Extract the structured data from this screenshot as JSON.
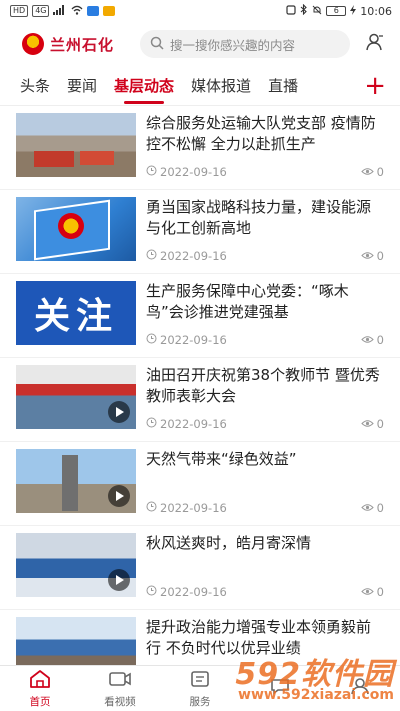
{
  "status_bar": {
    "left_badges": [
      "HD",
      "4G"
    ],
    "battery": "6",
    "time": "10:06"
  },
  "header": {
    "logo_text": "兰州石化",
    "search_placeholder": "搜一搜你感兴趣的内容",
    "icons": {
      "search": "search-icon",
      "user": "user-icon",
      "logo": "petrochina-logo-icon"
    },
    "brand_color": "#d0021b"
  },
  "tabs": {
    "items": [
      "头条",
      "要闻",
      "基层动态",
      "媒体报道",
      "直播"
    ],
    "active": "基层动态",
    "add_label": "+"
  },
  "articles": [
    {
      "title": "综合服务处运输大队党支部 疫情防控不松懈 全力以赴抓生产",
      "date": "2022-09-16",
      "views": "0",
      "has_video": false
    },
    {
      "title": "勇当国家战略科技力量，建设能源与化工创新高地",
      "date": "2022-09-16",
      "views": "0",
      "has_video": false
    },
    {
      "title": "生产服务保障中心党委：“啄木鸟”会诊推进党建强基",
      "date": "2022-09-16",
      "views": "0",
      "has_video": false,
      "thumb_text": "关注"
    },
    {
      "title": "油田召开庆祝第38个教师节 暨优秀教师表彰大会",
      "date": "2022-09-16",
      "views": "0",
      "has_video": true
    },
    {
      "title": "天然气带来“绿色效益”",
      "date": "2022-09-16",
      "views": "0",
      "has_video": true
    },
    {
      "title": "秋风送爽时，皓月寄深情",
      "date": "2022-09-16",
      "views": "0",
      "has_video": true
    },
    {
      "title": "提升政治能力增强专业本领勇毅前行 不负时代以优异业绩",
      "date": "",
      "views": "",
      "has_video": false
    }
  ],
  "bottom_nav": {
    "items": [
      {
        "label": "首页",
        "icon": "home-icon",
        "active": true
      },
      {
        "label": "看视频",
        "icon": "video-icon",
        "active": false
      },
      {
        "label": "服务",
        "icon": "service-icon",
        "active": false
      },
      {
        "label": "",
        "icon": "message-icon",
        "active": false
      },
      {
        "label": "",
        "icon": "profile-icon",
        "active": false
      }
    ]
  },
  "watermark": {
    "logo": "592软件园",
    "url": "www.592xiazai.com",
    "color": "#eb6e23"
  }
}
